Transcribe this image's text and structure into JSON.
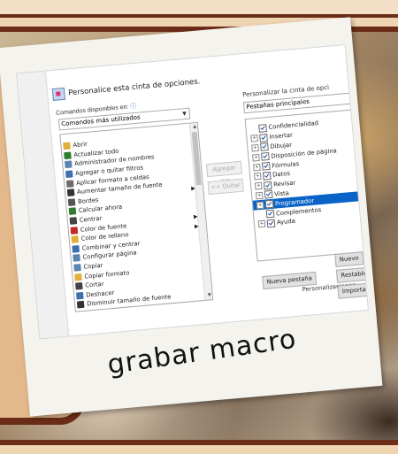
{
  "caption": "grabar macro",
  "dialog": {
    "heading": "Personalice esta cinta de opciones.",
    "commands_label": "Comandos disponibles en:",
    "commands_info": "ⓘ",
    "commands_select": "Comandos más utilizados",
    "commands": [
      {
        "label": "Abrir",
        "icon": "folder-icon",
        "color": "#e0b03b"
      },
      {
        "label": "Actualizar todo",
        "icon": "refresh-icon",
        "color": "#2f7d32"
      },
      {
        "label": "Administrador de nombres",
        "icon": "name-manager-icon",
        "color": "#5b84b1"
      },
      {
        "label": "Agregar o quitar filtros",
        "icon": "filter-icon",
        "color": "#3f6fb0"
      },
      {
        "label": "Aplicar formato a celdas",
        "icon": "format-cells-icon",
        "color": "#6c6c6c"
      },
      {
        "label": "Aumentar tamaño de fuente",
        "icon": "grow-font-icon",
        "color": "#333333"
      },
      {
        "label": "Bordes",
        "icon": "borders-icon",
        "color": "#555555"
      },
      {
        "label": "Calcular ahora",
        "icon": "calculator-icon",
        "color": "#2f7d32"
      },
      {
        "label": "Centrar",
        "icon": "center-icon",
        "color": "#444444"
      },
      {
        "label": "Color de fuente",
        "icon": "font-color-icon",
        "color": "#c62828"
      },
      {
        "label": "Color de relleno",
        "icon": "fill-color-icon",
        "color": "#e0b03b"
      },
      {
        "label": "Combinar y centrar",
        "icon": "merge-center-icon",
        "color": "#3f6fb0"
      },
      {
        "label": "Configurar página",
        "icon": "page-setup-icon",
        "color": "#5b84b1"
      },
      {
        "label": "Copiar",
        "icon": "copy-icon",
        "color": "#5b84b1"
      },
      {
        "label": "Copiar formato",
        "icon": "format-painter-icon",
        "color": "#e0b03b"
      },
      {
        "label": "Cortar",
        "icon": "cut-icon",
        "color": "#444444"
      },
      {
        "label": "Deshacer",
        "icon": "undo-icon",
        "color": "#3f6fb0"
      },
      {
        "label": "Disminuir tamaño de fuente",
        "icon": "shrink-font-icon",
        "color": "#333333"
      }
    ],
    "add_button": "Agregar >>",
    "remove_button": "<< Quitar",
    "ribbon_label": "Personalizar la cinta de opci",
    "ribbon_select": "Pestañas principales",
    "tabs": [
      {
        "label": "Confidencialidad",
        "expand": false,
        "checked": true,
        "selected": false
      },
      {
        "label": "Insertar",
        "expand": true,
        "checked": true,
        "selected": false
      },
      {
        "label": "Dibujar",
        "expand": true,
        "checked": true,
        "selected": false
      },
      {
        "label": "Disposición de página",
        "expand": true,
        "checked": true,
        "selected": false
      },
      {
        "label": "Fórmulas",
        "expand": true,
        "checked": true,
        "selected": false
      },
      {
        "label": "Datos",
        "expand": true,
        "checked": true,
        "selected": false
      },
      {
        "label": "Revisar",
        "expand": true,
        "checked": true,
        "selected": false
      },
      {
        "label": "Vista",
        "expand": true,
        "checked": true,
        "selected": false
      },
      {
        "label": "Programador",
        "expand": true,
        "checked": true,
        "selected": true
      },
      {
        "label": "Complementos",
        "expand": false,
        "checked": true,
        "selected": false
      },
      {
        "label": "Ayuda",
        "expand": true,
        "checked": true,
        "selected": false
      }
    ],
    "new_group_button": "Nuevo",
    "new_tab_button": "Nueva pestaña",
    "customizations_label": "Personalizaciones:",
    "reset_button": "Restable",
    "import_button": "Importa"
  }
}
